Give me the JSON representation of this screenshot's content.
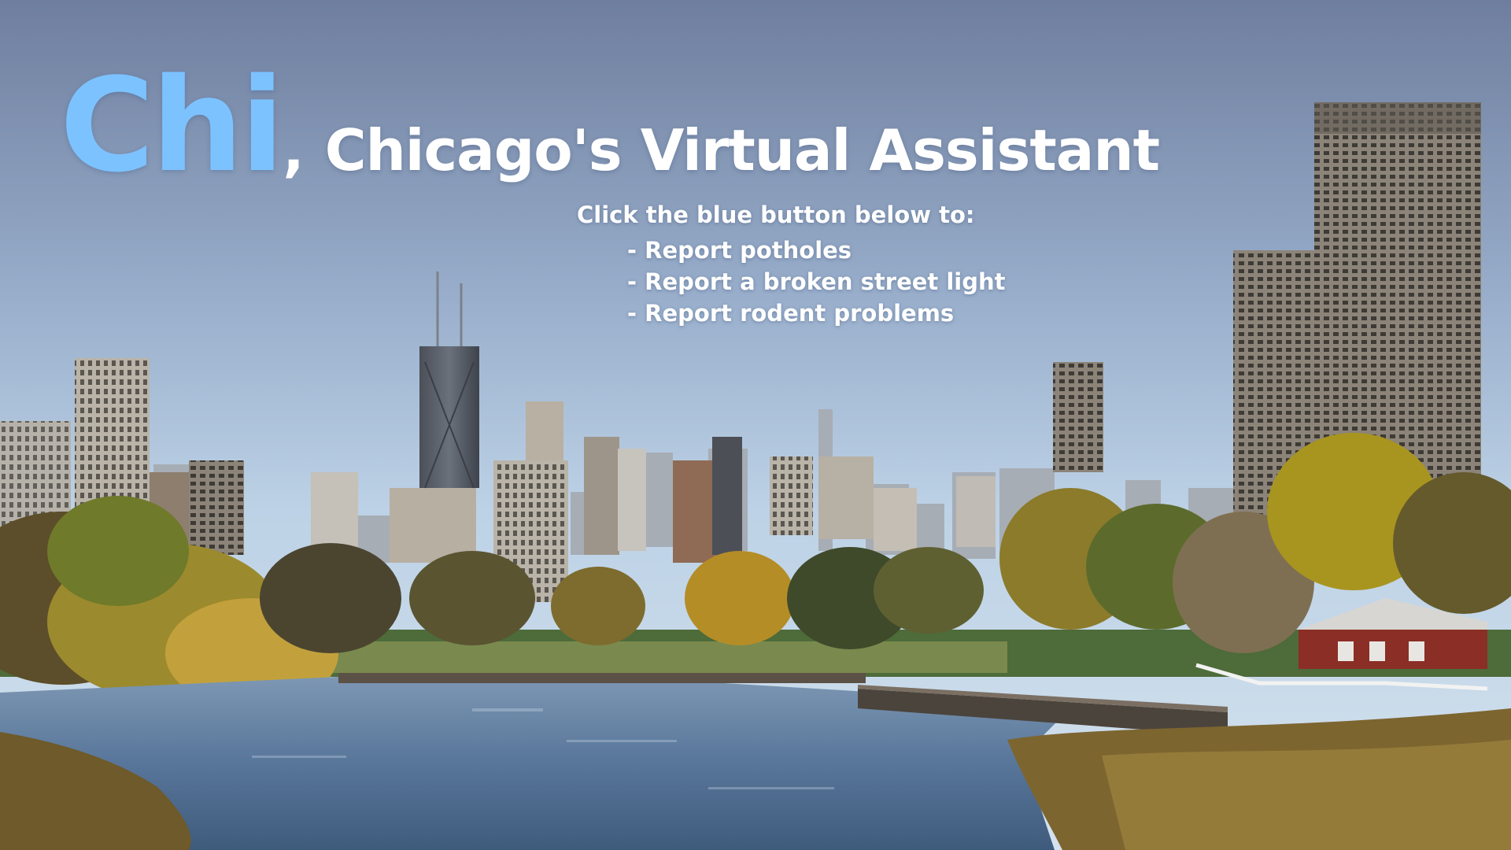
{
  "header": {
    "brand": "Chi",
    "separator": ",",
    "subtitle": "Chicago's Virtual Assistant"
  },
  "instructions": {
    "intro": "Click the blue button below to:",
    "items": [
      "Report potholes",
      "Report a broken street light",
      "Report rodent problems"
    ]
  },
  "colors": {
    "brand": "#7cc2ff",
    "text": "#ffffff",
    "sky_top": "#6f7f9e",
    "sky_bottom": "#c9dcec",
    "water": "#5d7a9a"
  }
}
